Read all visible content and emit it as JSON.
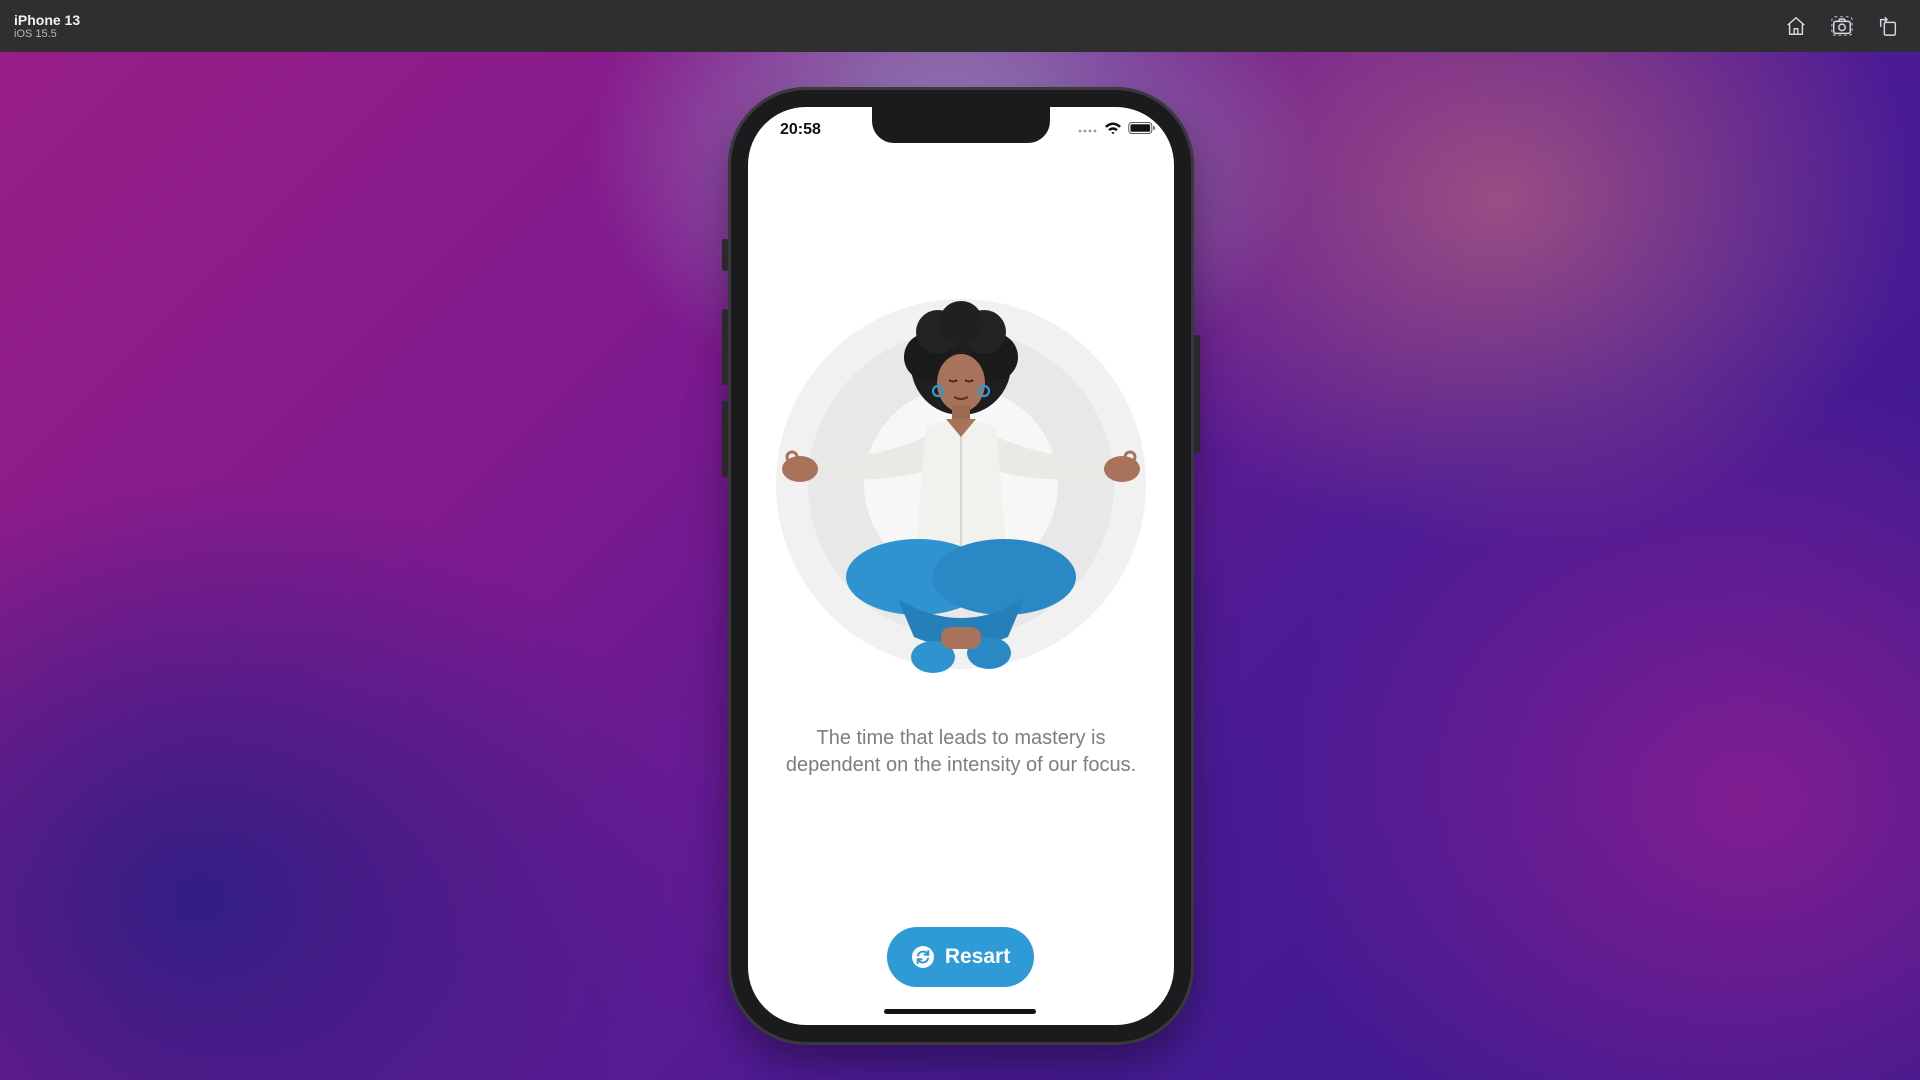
{
  "simulator": {
    "device_name": "iPhone 13",
    "os_version": "iOS 15.5",
    "actions": {
      "home_icon": "home-icon",
      "screenshot_icon": "camera-icon",
      "rotate_icon": "rotate-icon"
    }
  },
  "status_bar": {
    "time": "20:58",
    "signal_icon": "signal-dots-icon",
    "wifi_icon": "wifi-icon",
    "battery_icon": "battery-icon"
  },
  "screen": {
    "illustration": "meditating-person-illustration",
    "quote": "The time that leads to mastery is dependent on the intensity of our focus.",
    "restart_button": {
      "label": "Resart",
      "icon": "refresh-icon"
    }
  },
  "colors": {
    "accent": "#2e9bd6",
    "quote_text": "#7d7d82",
    "halo": "#ebebeb"
  }
}
